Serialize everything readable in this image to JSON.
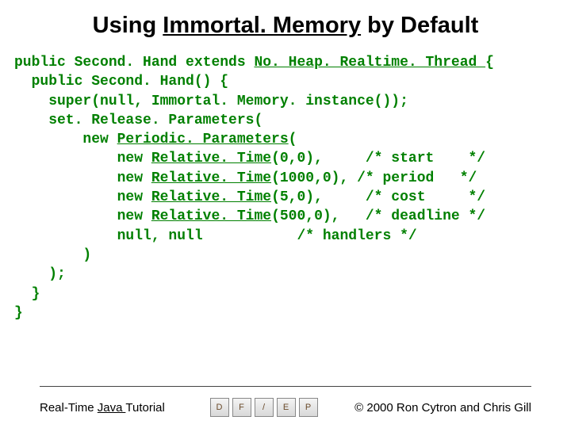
{
  "title": {
    "pre": "Using ",
    "ul": "Immortal. Memory",
    "post": " by Default"
  },
  "code": {
    "l1a": "public Second. Hand extends ",
    "l1u": "No. Heap. Realtime. Thread ",
    "l1b": "{",
    "l2": "  public Second. Hand() {",
    "l3": "    super(null, Immortal. Memory. instance());",
    "l4": "    set. Release. Parameters(",
    "l5a": "        new ",
    "l5u": "Periodic. Parameters",
    "l5b": "(",
    "l6a": "            new ",
    "l6u": "Relative. Time",
    "l6b": "(0,0),     /* start    */",
    "l7a": "            new ",
    "l7u": "Relative. Time",
    "l7b": "(1000,0), /* period   */",
    "l8a": "            new ",
    "l8u": "Relative. Time",
    "l8b": "(5,0),     /* cost     */",
    "l9a": "            new ",
    "l9u": "Relative. Time",
    "l9b": "(500,0),   /* deadline */",
    "l10": "            null, null           /* handlers */",
    "l11": "        )",
    "l12": "    );",
    "l13": "  }",
    "l14": "}"
  },
  "footer": {
    "left_pre": "Real-Time ",
    "left_ul": "Java ",
    "left_post": "Tutorial",
    "right": "2000 Ron Cytron and Chris Gill",
    "copy": "©"
  },
  "nav": {
    "b1": "D",
    "b2": "F",
    "b3": "/",
    "b4": "E",
    "b5": "P"
  }
}
